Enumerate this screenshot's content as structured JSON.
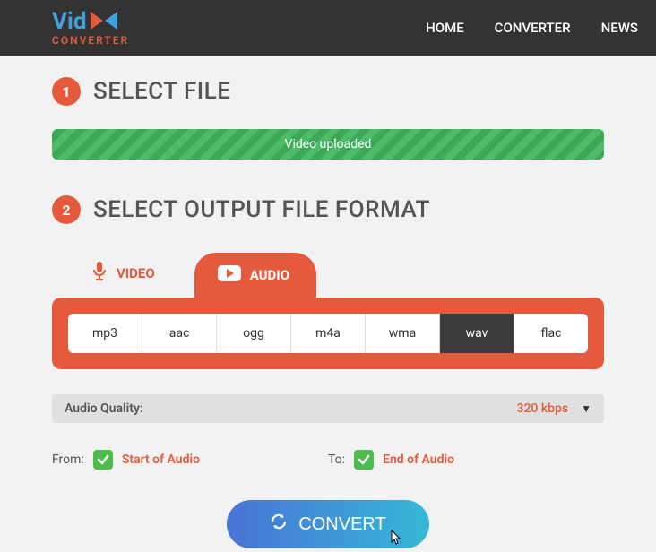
{
  "logo": {
    "text_top": "Vid",
    "text_bottom": "CONVERTER"
  },
  "nav": {
    "home": "HOME",
    "converter": "CONVERTER",
    "news": "NEWS"
  },
  "step1": {
    "num": "1",
    "title": "SELECT FILE",
    "status": "Video uploaded"
  },
  "step2": {
    "num": "2",
    "title": "SELECT OUTPUT FILE FORMAT"
  },
  "tabs": {
    "video": "VIDEO",
    "audio": "AUDIO"
  },
  "formats": {
    "mp3": "mp3",
    "aac": "aac",
    "ogg": "ogg",
    "m4a": "m4a",
    "wma": "wma",
    "wav": "wav",
    "flac": "flac",
    "selected": "wav"
  },
  "quality": {
    "label": "Audio Quality:",
    "value": "320 kbps"
  },
  "range": {
    "from_label": "From:",
    "from_value": "Start of Audio",
    "to_label": "To:",
    "to_value": "End of Audio"
  },
  "convert": {
    "label": "CONVERT"
  }
}
